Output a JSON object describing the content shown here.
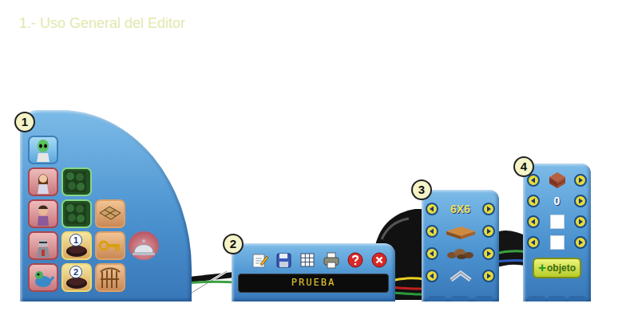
{
  "heading": "1.- Uso General del Editor",
  "palette": {
    "badge": "1",
    "characters": [
      {
        "selected": true
      },
      {
        "selected": false
      },
      {
        "selected": false
      },
      {
        "selected": false
      },
      {
        "selected": false
      }
    ],
    "level_marks": [
      "1",
      "2"
    ]
  },
  "toolbar": {
    "badge": "2",
    "display": "PRUEBA"
  },
  "map_panel": {
    "badge": "3",
    "size": "6X6"
  },
  "object_panel": {
    "badge": "4",
    "count": "0",
    "add_button": {
      "plus": "+",
      "label": "objeto"
    }
  }
}
